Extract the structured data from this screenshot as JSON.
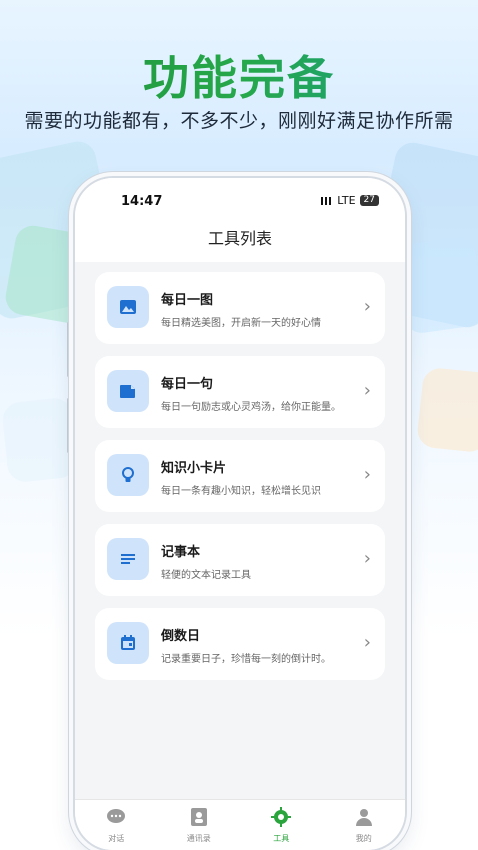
{
  "hero": {
    "title": "功能完备",
    "subtitle": "需要的功能都有，不多不少，刚刚好满足协作所需"
  },
  "status_bar": {
    "time": "14:47",
    "network": "LTE",
    "battery": "27"
  },
  "header": {
    "title": "工具列表"
  },
  "tools": [
    {
      "title": "每日一图",
      "desc": "每日精选美图，开启新一天的好心情",
      "icon": "image-icon"
    },
    {
      "title": "每日一句",
      "desc": "每日一句励志或心灵鸡汤，给你正能量。",
      "icon": "note-icon"
    },
    {
      "title": "知识小卡片",
      "desc": "每日一条有趣小知识，轻松增长见识",
      "icon": "lightbulb-icon"
    },
    {
      "title": "记事本",
      "desc": "轻便的文本记录工具",
      "icon": "notes-lines-icon"
    },
    {
      "title": "倒数日",
      "desc": "记录重要日子，珍惜每一刻的倒计时。",
      "icon": "calendar-icon"
    }
  ],
  "tabbar": {
    "items": [
      {
        "label": "对话",
        "icon": "chat-icon"
      },
      {
        "label": "通讯录",
        "icon": "contacts-icon"
      },
      {
        "label": "工具",
        "icon": "gear-icon"
      },
      {
        "label": "我的",
        "icon": "person-icon"
      }
    ],
    "active": 2
  },
  "colors": {
    "accent_green": "#2aa43c",
    "icon_bg": "#cfe3fb",
    "icon_fg": "#1f6fd1"
  }
}
